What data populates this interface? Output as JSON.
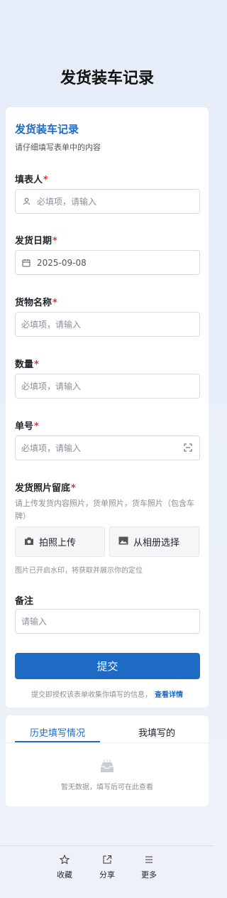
{
  "page": {
    "title": "发货装车记录"
  },
  "form": {
    "title": "发货装车记录",
    "description": "请仔细填写表单中的内容",
    "required_mark": "*",
    "fields": {
      "filler": {
        "label": "填表人",
        "placeholder": "必填项，请输入",
        "icon": "person-icon"
      },
      "ship_date": {
        "label": "发货日期",
        "value": "2025-09-08",
        "icon": "calendar-icon"
      },
      "goods_name": {
        "label": "货物名称",
        "placeholder": "必填项，请输入"
      },
      "quantity": {
        "label": "数量",
        "placeholder": "必填项，请输入"
      },
      "order_no": {
        "label": "单号",
        "placeholder": "必填项，请输入",
        "icon": "scan-icon"
      },
      "photos": {
        "label": "发货照片留底",
        "hint": "请上传发货内容照片，货单照片，货车照片（包含车牌）",
        "camera_button": "拍照上传",
        "album_button": "从相册选择",
        "watermark_note": "图片已开启水印，将获取并展示你的定位"
      },
      "remark": {
        "label": "备注",
        "placeholder": "请输入"
      }
    },
    "submit_label": "提交",
    "consent_text": "提交即授权该表单收集你填写的信息，",
    "consent_link": "查看详情"
  },
  "history": {
    "tabs": [
      "历史填写情况",
      "我填写的"
    ],
    "active_tab": 0,
    "empty_text": "暂无数据，填写后可在此查看"
  },
  "bottom_nav": [
    {
      "label": "收藏",
      "icon": "star-icon"
    },
    {
      "label": "分享",
      "icon": "share-icon"
    },
    {
      "label": "更多",
      "icon": "menu-icon"
    }
  ],
  "colors": {
    "accent": "#1e6bc6",
    "required": "#e03434"
  }
}
